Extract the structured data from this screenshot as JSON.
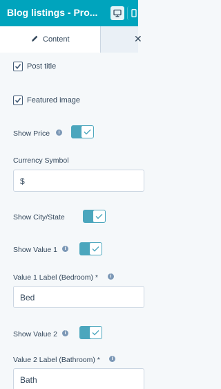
{
  "header": {
    "title": "Blog listings - Pro...",
    "desktop_icon": "desktop-icon",
    "mobile_icon": "mobile-icon"
  },
  "tabs": [
    {
      "label": "Content",
      "icon": "pencil-icon",
      "active": true
    },
    {
      "label": "",
      "icon": "close-icon",
      "active": false
    }
  ],
  "fields": {
    "post_title": {
      "label": "Post title",
      "checked": true
    },
    "featured_image": {
      "label": "Featured image",
      "checked": true
    },
    "show_price": {
      "label": "Show Price",
      "on": true
    },
    "currency_symbol": {
      "label": "Currency Symbol",
      "value": "$"
    },
    "show_city_state": {
      "label": "Show City/State",
      "on": true
    },
    "show_value_1": {
      "label": "Show Value 1",
      "on": true
    },
    "value_1_label": {
      "label": "Value 1 Label (Bedroom) *",
      "value": "Bed"
    },
    "show_value_2": {
      "label": "Show Value 2",
      "on": true
    },
    "value_2_label": {
      "label": "Value 2 Label (Bathroom) *",
      "value": "Bath"
    }
  },
  "colors": {
    "header_bg": "#00a4bd",
    "toggle_on": "#4ba6bd",
    "panel_bg": "#f5f8fa"
  }
}
